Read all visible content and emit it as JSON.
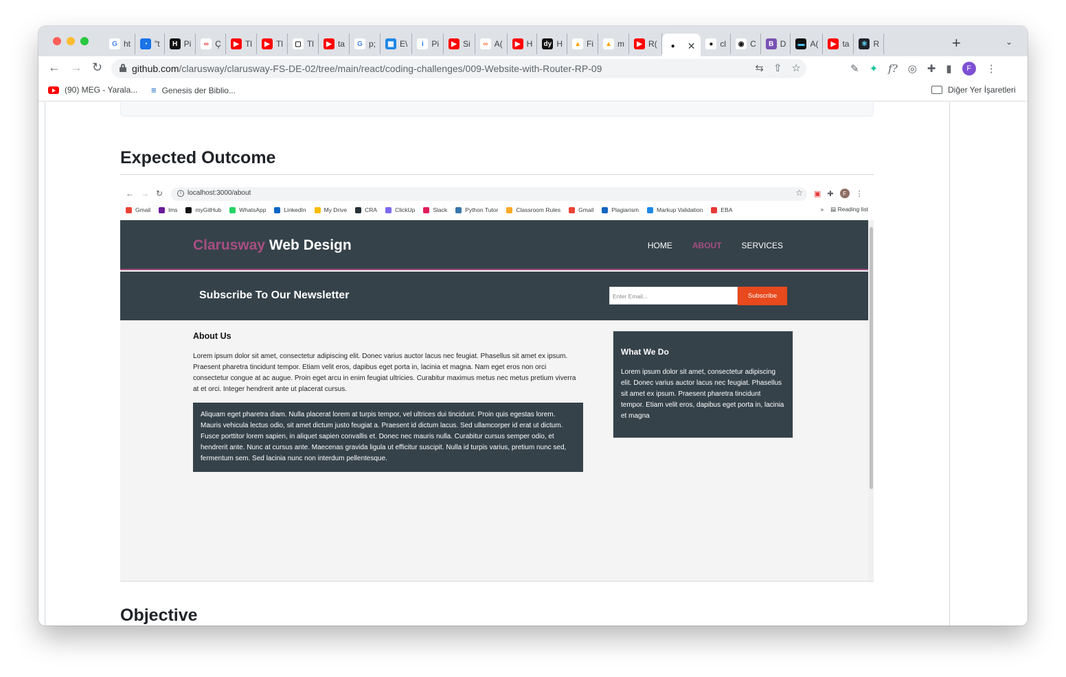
{
  "tabs": [
    {
      "text": "ht",
      "icon": "google-icon",
      "color": "#ffffff",
      "glyph": "G",
      "fg": "#4285f4"
    },
    {
      "text": "\"t",
      "icon": "speech-bubble-icon",
      "color": "#1a73e8",
      "glyph": "◔",
      "fg": "#ffffff"
    },
    {
      "text": "Pi",
      "icon": "hackerrank-icon",
      "color": "#111111",
      "glyph": "H",
      "fg": "#ffffff"
    },
    {
      "text": "Ç",
      "icon": "infinity-icon",
      "color": "#ffffff",
      "glyph": "∞",
      "fg": "#e53935"
    },
    {
      "text": "Tl",
      "icon": "youtube-icon",
      "color": "#ff0000",
      "glyph": "▶",
      "fg": "#ffffff"
    },
    {
      "text": "Tl",
      "icon": "youtube-icon",
      "color": "#ff0000",
      "glyph": "▶",
      "fg": "#ffffff"
    },
    {
      "text": "Tl",
      "icon": "tv-icon",
      "color": "#ffffff",
      "glyph": "▢",
      "fg": "#111111"
    },
    {
      "text": "ta",
      "icon": "youtube-icon",
      "color": "#ff0000",
      "glyph": "▶",
      "fg": "#ffffff"
    },
    {
      "text": "p;",
      "icon": "google-icon",
      "color": "#ffffff",
      "glyph": "G",
      "fg": "#4285f4"
    },
    {
      "text": "E\\",
      "icon": "grid-icon",
      "color": "#1e88e5",
      "glyph": "▦",
      "fg": "#ffffff"
    },
    {
      "text": "Pi",
      "icon": "info-icon",
      "color": "#ffffff",
      "glyph": "i",
      "fg": "#1a73e8"
    },
    {
      "text": "Si",
      "icon": "youtube-icon",
      "color": "#ff0000",
      "glyph": "▶",
      "fg": "#ffffff"
    },
    {
      "text": "A(",
      "icon": "glasses-icon",
      "color": "#ffffff",
      "glyph": "∞",
      "fg": "#ff7043"
    },
    {
      "text": "H",
      "icon": "youtube-icon",
      "color": "#ff0000",
      "glyph": "▶",
      "fg": "#ffffff"
    },
    {
      "text": "H",
      "icon": "dy-icon",
      "color": "#111111",
      "glyph": "dy",
      "fg": "#ffffff"
    },
    {
      "text": "Fi",
      "icon": "firebase-icon",
      "color": "#ffffff",
      "glyph": "▲",
      "fg": "#ffa000"
    },
    {
      "text": "m",
      "icon": "firebase-icon",
      "color": "#ffffff",
      "glyph": "▲",
      "fg": "#ffa000"
    },
    {
      "text": "R(",
      "icon": "youtube-icon",
      "color": "#ff0000",
      "glyph": "▶",
      "fg": "#ffffff"
    }
  ],
  "tabs_after": [
    {
      "text": "cl",
      "icon": "github-icon",
      "color": "#ffffff",
      "glyph": "●",
      "fg": "#111111"
    },
    {
      "text": "C",
      "icon": "copilot-icon",
      "color": "#ffffff",
      "glyph": "◉",
      "fg": "#111111"
    },
    {
      "text": "D",
      "icon": "bootstrap-icon",
      "color": "#7952b3",
      "glyph": "B",
      "fg": "#ffffff"
    },
    {
      "text": "A(",
      "icon": "terminal-icon",
      "color": "#111111",
      "glyph": "▬",
      "fg": "#4fc3f7"
    },
    {
      "text": "ta",
      "icon": "youtube-icon",
      "color": "#ff0000",
      "glyph": "▶",
      "fg": "#ffffff"
    },
    {
      "text": "R",
      "icon": "react-icon",
      "color": "#20232a",
      "glyph": "⚛",
      "fg": "#61dafb"
    }
  ],
  "active_tab": {
    "icon": "github-icon",
    "close": "✕"
  },
  "browser": {
    "url_host": "github.com",
    "url_path": "/clarusway/clarusway-FS-DE-02/tree/main/react/coding-challenges/009-Website-with-Router-RP-09",
    "profile_initial": "F",
    "nav_back": "←",
    "nav_forward": "→",
    "nav_reload": "↻",
    "new_tab": "+",
    "tab_menu": "⌄"
  },
  "bookmarks": [
    {
      "label": "(90) MEG - Yarala...",
      "icon": "youtube-icon"
    },
    {
      "label": "Genesis der Biblio...",
      "icon": "book-icon"
    }
  ],
  "bookmarks_other": "Diğer Yer İşaretleri",
  "page": {
    "heading_expected": "Expected Outcome",
    "heading_objective": "Objective"
  },
  "inner_browser": {
    "url": "localhost:3000/about",
    "profile_initial": "F",
    "bookmarks": [
      {
        "label": "Gmail",
        "color": "#ea4335"
      },
      {
        "label": "lms",
        "color": "#6a1b9a"
      },
      {
        "label": "myGitHub",
        "color": "#111111"
      },
      {
        "label": "WhatsApp",
        "color": "#25d366"
      },
      {
        "label": "LinkedIn",
        "color": "#0a66c2"
      },
      {
        "label": "My Drive",
        "color": "#fbbc04"
      },
      {
        "label": "CRA",
        "color": "#263238"
      },
      {
        "label": "ClickUp",
        "color": "#7b68ee"
      },
      {
        "label": "Slack",
        "color": "#e01e5a"
      },
      {
        "label": "Python Tutor",
        "color": "#3776ab"
      },
      {
        "label": "Classroom Rules",
        "color": "#f9a825"
      },
      {
        "label": "Gmail",
        "color": "#ea4335"
      },
      {
        "label": "Plagiarism",
        "color": "#1565c0"
      },
      {
        "label": "Markup Validation",
        "color": "#1e88e5"
      },
      {
        "label": "EBA",
        "color": "#e53935"
      }
    ],
    "more": "»",
    "reading_list": "Reading list"
  },
  "site": {
    "brand_accent": "Clarusway",
    "brand_rest": "Web Design",
    "nav": [
      "HOME",
      "ABOUT",
      "SERVICES"
    ],
    "active_nav": "ABOUT",
    "newsletter_title": "Subscribe To Our Newsletter",
    "email_placeholder": "Enter Email...",
    "subscribe_label": "Subscribe",
    "about_title": "About Us",
    "about_text": "Lorem ipsum dolor sit amet, consectetur adipiscing elit. Donec varius auctor lacus nec feugiat. Phasellus sit amet ex ipsum. Praesent pharetra tincidunt tempor. Etiam velit eros, dapibus eget porta in, lacinia et magna. Nam eget eros non orci consectetur congue at ac augue. Proin eget arcu in enim feugiat ultricies. Curabitur maximus metus nec metus pretium viverra at et orci. Integer hendrerit ante ut placerat cursus.",
    "dark_text": "Aliquam eget pharetra diam. Nulla placerat lorem at turpis tempor, vel ultrices dui tincidunt. Proin quis egestas lorem. Mauris vehicula lectus odio, sit amet dictum justo feugiat a. Praesent id dictum lacus. Sed ullamcorper id erat ut dictum. Fusce porttitor lorem sapien, in aliquet sapien convallis et. Donec nec mauris nulla. Curabitur cursus semper odio, et hendrerit ante. Nunc at cursus ante. Maecenas gravida ligula ut efficitur suscipit. Nulla id turpis varius, pretium nunc sed, fermentum sem. Sed lacinia nunc non interdum pellentesque.",
    "side_title": "What We Do",
    "side_text": "Lorem ipsum dolor sit amet, consectetur adipiscing elit. Donec varius auctor lacus nec feugiat. Phasellus sit amet ex ipsum. Praesent pharetra tincidunt tempor. Etiam velit eros, dapibus eget porta in, lacinia et magna"
  },
  "colors": {
    "site_dark": "#35424a",
    "site_accent": "#a84e82",
    "subscribe": "#e8491d"
  }
}
